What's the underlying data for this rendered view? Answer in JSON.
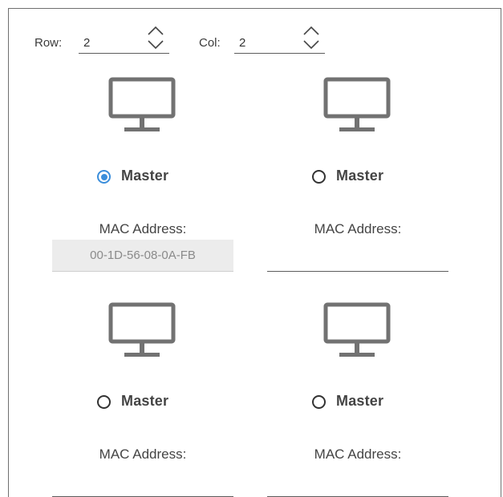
{
  "grid": {
    "row_label": "Row:",
    "row_value": "2",
    "col_label": "Col:",
    "col_value": "2"
  },
  "cells": [
    {
      "master_label": "Master",
      "selected": true,
      "mac_label": "MAC Address:",
      "mac_value": "00-1D-56-08-0A-FB"
    },
    {
      "master_label": "Master",
      "selected": false,
      "mac_label": "MAC Address:",
      "mac_value": ""
    },
    {
      "master_label": "Master",
      "selected": false,
      "mac_label": "MAC Address:",
      "mac_value": ""
    },
    {
      "master_label": "Master",
      "selected": false,
      "mac_label": "MAC Address:",
      "mac_value": ""
    }
  ],
  "colors": {
    "accent": "#3b8edb",
    "icon": "#727272",
    "frame": "#6f6f6f"
  },
  "icons": {
    "monitor": "monitor-icon",
    "spin_up": "chevron-up-icon",
    "spin_down": "chevron-down-icon"
  }
}
